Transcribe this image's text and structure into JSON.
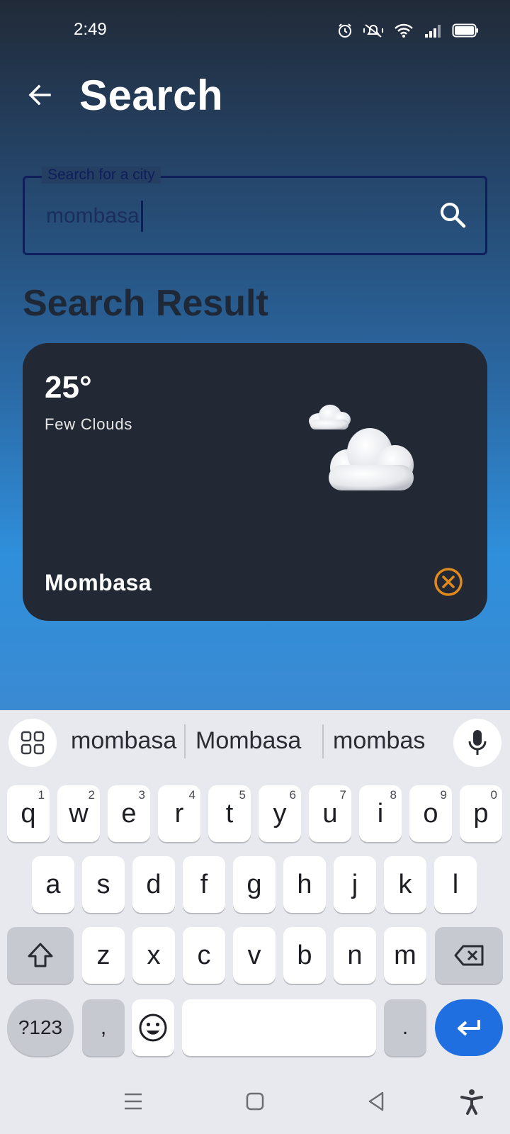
{
  "status_bar": {
    "time": "2:49"
  },
  "header": {
    "title": "Search",
    "back_icon": "arrow-left-icon"
  },
  "search": {
    "label": "Search for a city",
    "value": "mombasa",
    "icon": "search-icon"
  },
  "results": {
    "title": "Search Result",
    "items": [
      {
        "temperature": "25°",
        "condition": "Few Clouds",
        "city": "Mombasa",
        "icon": "cloud-icon",
        "remove_icon": "close-circle-icon",
        "remove_color": "#e08a1e"
      }
    ]
  },
  "keyboard": {
    "suggestions": [
      "mombasa",
      "Mombasa",
      "mombas"
    ],
    "row1": [
      {
        "key": "q",
        "hint": "1"
      },
      {
        "key": "w",
        "hint": "2"
      },
      {
        "key": "e",
        "hint": "3"
      },
      {
        "key": "r",
        "hint": "4"
      },
      {
        "key": "t",
        "hint": "5"
      },
      {
        "key": "y",
        "hint": "6"
      },
      {
        "key": "u",
        "hint": "7"
      },
      {
        "key": "i",
        "hint": "8"
      },
      {
        "key": "o",
        "hint": "9"
      },
      {
        "key": "p",
        "hint": "0"
      }
    ],
    "row2": [
      "a",
      "s",
      "d",
      "f",
      "g",
      "h",
      "j",
      "k",
      "l"
    ],
    "row3": [
      "z",
      "x",
      "c",
      "v",
      "b",
      "n",
      "m"
    ],
    "symbols_label": "?123",
    "comma_label": ",",
    "period_label": ".",
    "accent_color": "#1f6fe0"
  }
}
